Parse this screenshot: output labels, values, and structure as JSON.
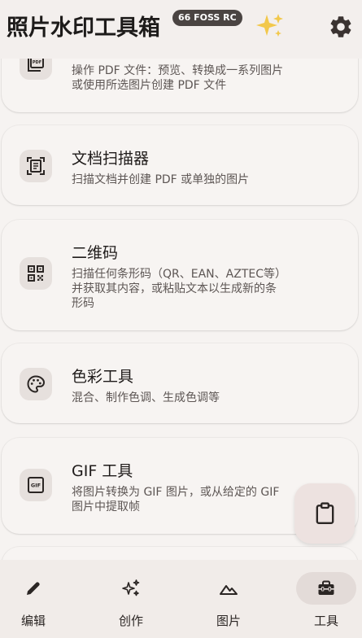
{
  "top_bar": {
    "title": "照片水印工具箱",
    "version_badge": "66 FOSS RC"
  },
  "tools": [
    {
      "title": "",
      "description": "操作 PDF 文件：预览、转换成一系列图片\n或使用所选图片创建 PDF 文件",
      "icon": "pdf-icon"
    },
    {
      "title": "文档扫描器",
      "description": "扫描文档并创建 PDF 或单独的图片",
      "icon": "document-scanner-icon"
    },
    {
      "title": "二维码",
      "description": "扫描任何条形码（QR、EAN、AZTEC等）\n并获取其内容，或粘贴文本以生成新的条\n形码",
      "icon": "qr-code-icon"
    },
    {
      "title": "色彩工具",
      "description": "混合、制作色调、生成色调等",
      "icon": "palette-icon"
    },
    {
      "title": "GIF 工具",
      "description": "将图片转换为 GIF 图片，或从给定的 GIF\n图片中提取帧",
      "icon": "gif-icon"
    }
  ],
  "fab": {
    "icon": "clipboard-icon"
  },
  "bottom_nav": {
    "items": [
      {
        "label": "编辑",
        "icon": "edit-pencil-icon",
        "active": false
      },
      {
        "label": "创作",
        "icon": "sparkles-icon",
        "active": false
      },
      {
        "label": "图片",
        "icon": "landscape-icon",
        "active": false
      },
      {
        "label": "工具",
        "icon": "toolbox-icon",
        "active": true
      }
    ]
  },
  "colors": {
    "background": "#f6f3f1",
    "card": "#f7f4f2",
    "icon_bg": "#e6e0dd",
    "badge_bg": "#4a4442",
    "nav_active_pill": "#e3dbd8",
    "fab_bg": "#ede2e0",
    "sparkle": "#f2c84b"
  }
}
